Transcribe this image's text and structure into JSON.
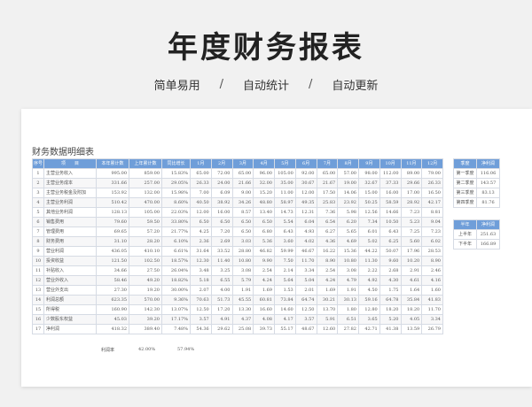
{
  "hero": {
    "title": "年度财务报表",
    "tags": [
      "简单易用",
      "自动统计",
      "自动更新"
    ],
    "separator": "/"
  },
  "sheet": {
    "title": "财务数据明细表",
    "headers": [
      "序号",
      "项　　目",
      "本年累计数",
      "上年累计数",
      "同比增长",
      "1月",
      "2月",
      "3月",
      "4月",
      "5月",
      "6月",
      "7月",
      "8月",
      "9月",
      "10月",
      "11月",
      "12月"
    ],
    "rows": [
      [
        "1",
        "主营业务收入",
        "995.00",
        "859.00",
        "15.83%",
        "65.00",
        "72.00",
        "65.00",
        "96.00",
        "105.00",
        "92.00",
        "65.00",
        "57.00",
        "98.00",
        "112.00",
        "89.00",
        "79.00"
      ],
      [
        "2",
        "主营业务成本",
        "331.66",
        "257.00",
        "29.05%",
        "26.33",
        "24.00",
        "21.66",
        "32.00",
        "35.00",
        "30.67",
        "21.67",
        "19.00",
        "32.67",
        "37.33",
        "29.66",
        "26.33"
      ],
      [
        "3",
        "主营业务税金及附加",
        "153.92",
        "132.00",
        "15.98%",
        "7.00",
        "6.09",
        "9.00",
        "15.20",
        "11.00",
        "12.00",
        "17.50",
        "14.06",
        "15.00",
        "16.00",
        "17.00",
        "16.50"
      ],
      [
        "4",
        "主营业务利润",
        "510.42",
        "470.00",
        "8.60%",
        "40.50",
        "38.92",
        "34.26",
        "48.80",
        "58.97",
        "49.35",
        "25.83",
        "23.92",
        "50.25",
        "58.59",
        "28.92",
        "42.17"
      ],
      [
        "5",
        "其他业务利润",
        "128.13",
        "105.00",
        "22.03%",
        "12.00",
        "16.00",
        "8.57",
        "13.40",
        "14.73",
        "12.31",
        "7.36",
        "5.98",
        "12.56",
        "14.66",
        "7.23",
        "8.81"
      ],
      [
        "6",
        "销售费用",
        "79.60",
        "59.50",
        "33.80%",
        "6.50",
        "6.50",
        "6.50",
        "6.50",
        "5.54",
        "6.04",
        "6.54",
        "6.20",
        "7.34",
        "10.50",
        "5.23",
        "9.04"
      ],
      [
        "7",
        "管理费用",
        "69.65",
        "57.20",
        "21.77%",
        "4.25",
        "7.20",
        "6.50",
        "6.80",
        "6.43",
        "4.93",
        "6.27",
        "5.65",
        "6.01",
        "6.43",
        "7.25",
        "7.23"
      ],
      [
        "8",
        "财务费用",
        "31.10",
        "28.20",
        "6.10%",
        "2.36",
        "2.69",
        "3.03",
        "5.36",
        "3.60",
        "4.02",
        "4.36",
        "4.69",
        "5.02",
        "6.25",
        "5.60",
        "6.02"
      ],
      [
        "9",
        "营业利润",
        "436.05",
        "410.10",
        "6.61%",
        "31.64",
        "33.52",
        "28.80",
        "46.82",
        "59.99",
        "46.67",
        "16.22",
        "15.36",
        "44.22",
        "50.07",
        "17.96",
        "28.53"
      ],
      [
        "10",
        "投资收益",
        "121.50",
        "102.50",
        "18.57%",
        "12.30",
        "11.40",
        "10.80",
        "9.90",
        "7.50",
        "11.70",
        "8.90",
        "10.80",
        "11.30",
        "9.60",
        "10.20",
        "8.90"
      ],
      [
        "11",
        "补贴收入",
        "34.66",
        "27.50",
        "26.04%",
        "3.48",
        "3.25",
        "3.08",
        "2.54",
        "2.14",
        "3.34",
        "2.54",
        "3.08",
        "2.22",
        "2.68",
        "2.91",
        "2.46"
      ],
      [
        "12",
        "营业外收入",
        "58.46",
        "49.20",
        "18.82%",
        "5.18",
        "6.55",
        "5.79",
        "4.24",
        "5.64",
        "5.04",
        "4.24",
        "4.79",
        "4.92",
        "4.30",
        "4.61",
        "4.16"
      ],
      [
        "13",
        "营业外支出",
        "27.30",
        "19.20",
        "30.00%",
        "2.07",
        "4.00",
        "1.91",
        "1.69",
        "1.53",
        "2.01",
        "1.69",
        "1.91",
        "4.50",
        "1.75",
        "1.64",
        "1.60"
      ],
      [
        "14",
        "利润总额",
        "623.35",
        "570.00",
        "9.36%",
        "70.63",
        "51.73",
        "45.55",
        "60.81",
        "73.84",
        "64.74",
        "30.21",
        "30.13",
        "59.16",
        "64.78",
        "35.84",
        "41.83"
      ],
      [
        "15",
        "所得税",
        "160.90",
        "142.30",
        "13.07%",
        "12.50",
        "17.20",
        "13.30",
        "16.60",
        "14.60",
        "12.50",
        "13.70",
        "1.80",
        "12.80",
        "18.20",
        "18.20",
        "11.70"
      ],
      [
        "16",
        "少数股东权益",
        "45.03",
        "39.20",
        "17.17%",
        "3.57",
        "4.91",
        "4.37",
        "4.08",
        "4.17",
        "3.57",
        "5.91",
        "6.51",
        "3.65",
        "5.20",
        "4.05",
        "3.34"
      ],
      [
        "17",
        "净利润",
        "418.32",
        "389.40",
        "7.48%",
        "54.36",
        "29.62",
        "25.08",
        "39.73",
        "55.17",
        "48.67",
        "12.60",
        "27.82",
        "42.71",
        "41.38",
        "13.59",
        "26.79"
      ]
    ],
    "footer": {
      "label": "利润率",
      "current": "42.00%",
      "previous": "57.94%"
    }
  },
  "quarter_table": {
    "headers": [
      "季度",
      "净利润"
    ],
    "rows": [
      [
        "第一季度",
        "116.06"
      ],
      [
        "第二季度",
        "143.57"
      ],
      [
        "第三季度",
        "83.13"
      ],
      [
        "第四季度",
        "81.76"
      ]
    ]
  },
  "half_table": {
    "headers": [
      "半年",
      "净利润"
    ],
    "rows": [
      [
        "上半年",
        "251.63"
      ],
      [
        "下半年",
        "166.89"
      ]
    ]
  },
  "colors": {
    "header": "#6f9ed9",
    "border": "#d6dbe4",
    "background": "#f1f1f1"
  }
}
